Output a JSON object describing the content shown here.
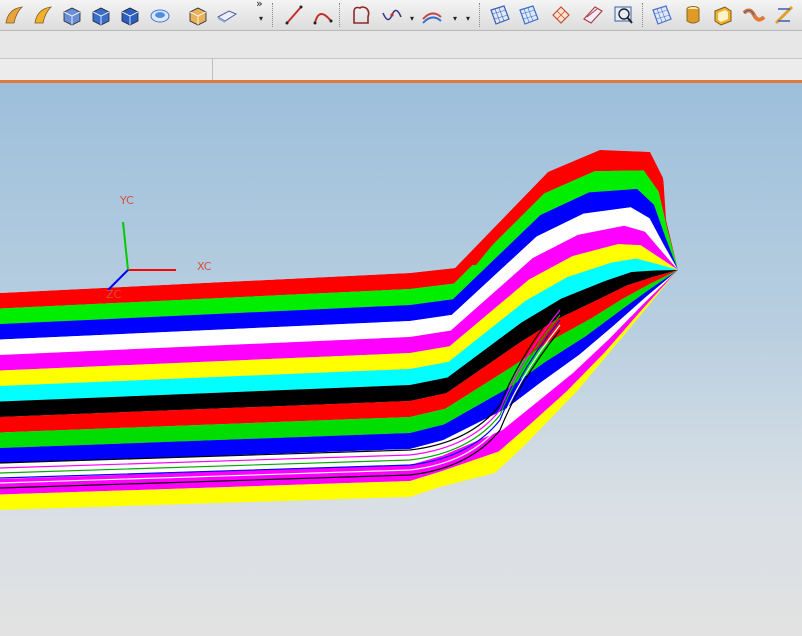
{
  "toolbar": {
    "tools": [
      {
        "name": "sweep-icon",
        "color": "#e8a33a"
      },
      {
        "name": "surface-icon",
        "color": "#f2b12d"
      },
      {
        "name": "box-icon",
        "color": "#6a8fd6"
      },
      {
        "name": "block-icon",
        "color": "#3a6ec8"
      },
      {
        "name": "cube-icon",
        "color": "#2d5fbf"
      },
      {
        "name": "pad-icon",
        "color": "#4a8fe0"
      },
      {
        "name": "extrude-icon",
        "color": "#e8b25a"
      },
      {
        "name": "slab-icon",
        "color": "#8aa8d8"
      },
      {
        "name": "line-icon",
        "color": "#c43030"
      },
      {
        "name": "arc-icon",
        "color": "#c43030"
      },
      {
        "name": "sketch-icon",
        "color": "#8a2a2a"
      },
      {
        "name": "spline-icon",
        "color": "#3a3a8a"
      },
      {
        "name": "offset-curve-icon",
        "color": "#c44a4a"
      },
      {
        "name": "face-icon",
        "color": "#3a5fb0"
      },
      {
        "name": "mesh-icon",
        "color": "#3a6ec8"
      },
      {
        "name": "trim-icon",
        "color": "#c45030"
      },
      {
        "name": "blend-icon",
        "color": "#b04040"
      },
      {
        "name": "zoom-face-icon",
        "color": "#3a5fb0"
      },
      {
        "name": "sheet-icon",
        "color": "#4a6fd0"
      },
      {
        "name": "cylinder-icon",
        "color": "#e09a2a"
      },
      {
        "name": "shell-icon",
        "color": "#f0b030"
      },
      {
        "name": "ribbon-icon",
        "color": "#e07a3a"
      },
      {
        "name": "measure-icon",
        "color": "#e0a030"
      }
    ],
    "more_glyph": "»"
  },
  "wcs": {
    "x_label": "XC",
    "y_label": "YC",
    "z_label": "ZC"
  },
  "model": {
    "stripe_colors": [
      "#ff0000",
      "#00ee00",
      "#0000ff",
      "#ffffff",
      "#ff00ff",
      "#ffff00",
      "#00ffff",
      "#000000",
      "#ff0000",
      "#00dd00",
      "#0000ff",
      "#ffffff",
      "#ff00ff",
      "#ffff00"
    ]
  }
}
